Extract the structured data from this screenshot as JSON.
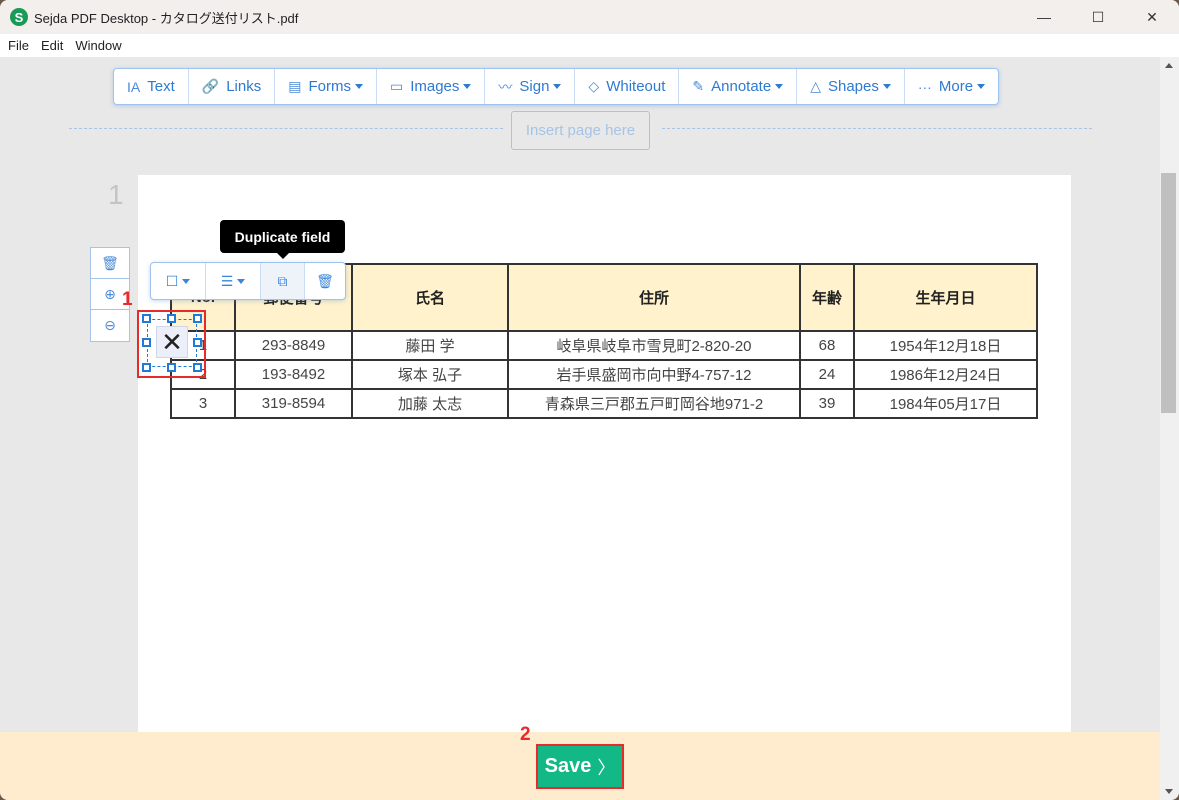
{
  "window": {
    "title": "Sejda PDF Desktop - カタログ送付リスト.pdf",
    "logo_letter": "S",
    "controls": {
      "minimize": "—",
      "maximize": "☐",
      "close": "✕"
    }
  },
  "menu": [
    "File",
    "Edit",
    "Window"
  ],
  "toolbar": [
    {
      "label": "Text",
      "icon": "text-icon",
      "glyph": "IA",
      "dropdown": false
    },
    {
      "label": "Links",
      "icon": "link-icon",
      "glyph": "🔗",
      "dropdown": false
    },
    {
      "label": "Forms",
      "icon": "forms-icon",
      "glyph": "▤",
      "dropdown": true
    },
    {
      "label": "Images",
      "icon": "image-icon",
      "glyph": "▭",
      "dropdown": true
    },
    {
      "label": "Sign",
      "icon": "signature-icon",
      "glyph": "〰",
      "dropdown": true
    },
    {
      "label": "Whiteout",
      "icon": "eraser-icon",
      "glyph": "◇",
      "dropdown": false
    },
    {
      "label": "Annotate",
      "icon": "pen-icon",
      "glyph": "✎",
      "dropdown": true
    },
    {
      "label": "Shapes",
      "icon": "shapes-icon",
      "glyph": "△",
      "dropdown": true
    },
    {
      "label": "More",
      "icon": "ellipsis-icon",
      "glyph": "···",
      "dropdown": true
    }
  ],
  "insert_page_label": "Insert page here",
  "page_number": "1",
  "side_tools": [
    {
      "name": "delete-page-icon",
      "glyph": "🗑"
    },
    {
      "name": "zoom-in-icon",
      "glyph": "⊕"
    },
    {
      "name": "zoom-out-icon",
      "glyph": "⊖"
    }
  ],
  "field_toolbar": {
    "tooltip": "Duplicate field",
    "buttons": [
      {
        "name": "field-type-button",
        "glyph": "☐",
        "dropdown": true
      },
      {
        "name": "field-options-button",
        "glyph": "☰",
        "dropdown": true
      },
      {
        "name": "duplicate-field-button",
        "glyph": "⧉",
        "dropdown": false
      },
      {
        "name": "delete-field-button",
        "glyph": "🗑",
        "dropdown": false
      }
    ]
  },
  "table": {
    "headers": [
      "No.",
      "郵便番号",
      "氏名",
      "住所",
      "年齢",
      "生年月日"
    ],
    "rows": [
      [
        "1",
        "293-8849",
        "藤田 学",
        "岐阜県岐阜市雪見町2-820-20",
        "68",
        "1954年12月18日"
      ],
      [
        "2",
        "193-8492",
        "塚本 弘子",
        "岩手県盛岡市向中野4-757-12",
        "24",
        "1986年12月24日"
      ],
      [
        "3",
        "319-8594",
        "加藤 太志",
        "青森県三戸郡五戸町岡谷地971-2",
        "39",
        "1984年05月17日"
      ]
    ]
  },
  "selected_field": {
    "glyph": "✕"
  },
  "annotations": {
    "step1": "1",
    "step2": "2"
  },
  "footer": {
    "save_label": "Save",
    "save_arrow": "〉"
  },
  "colors": {
    "accent": "#2e7ad1",
    "save": "#12b886",
    "annotation": "#e62b2b",
    "header_fill": "#fff2cc",
    "footer": "#ffebcd"
  }
}
